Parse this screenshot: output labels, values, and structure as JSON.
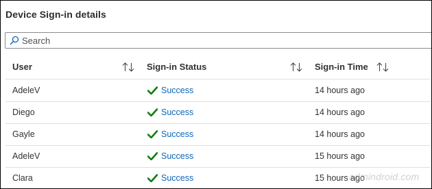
{
  "panel": {
    "title": "Device Sign-in details"
  },
  "search": {
    "placeholder": "Search",
    "value": ""
  },
  "columns": [
    {
      "label": "User",
      "sort_icon": "sort-up-down-icon"
    },
    {
      "label": "Sign-in Status",
      "sort_icon": "sort-up-down-icon"
    },
    {
      "label": "Sign-in Time",
      "sort_icon": "sort-up-down-icon"
    }
  ],
  "rows": [
    {
      "user": "AdeleV",
      "status": "Success",
      "time": "14 hours ago"
    },
    {
      "user": "Diego",
      "status": "Success",
      "time": "14 hours ago"
    },
    {
      "user": "Gayle",
      "status": "Success",
      "time": "14 hours ago"
    },
    {
      "user": "AdeleV",
      "status": "Success",
      "time": "15 hours ago"
    },
    {
      "user": "Clara",
      "status": "Success",
      "time": "15 hours ago"
    }
  ],
  "status_icon": "checkmark-icon",
  "colors": {
    "success_check": "#107c10",
    "link": "#0b66b6",
    "divider": "#e1dfdd"
  },
  "watermark": "admindroid.com"
}
